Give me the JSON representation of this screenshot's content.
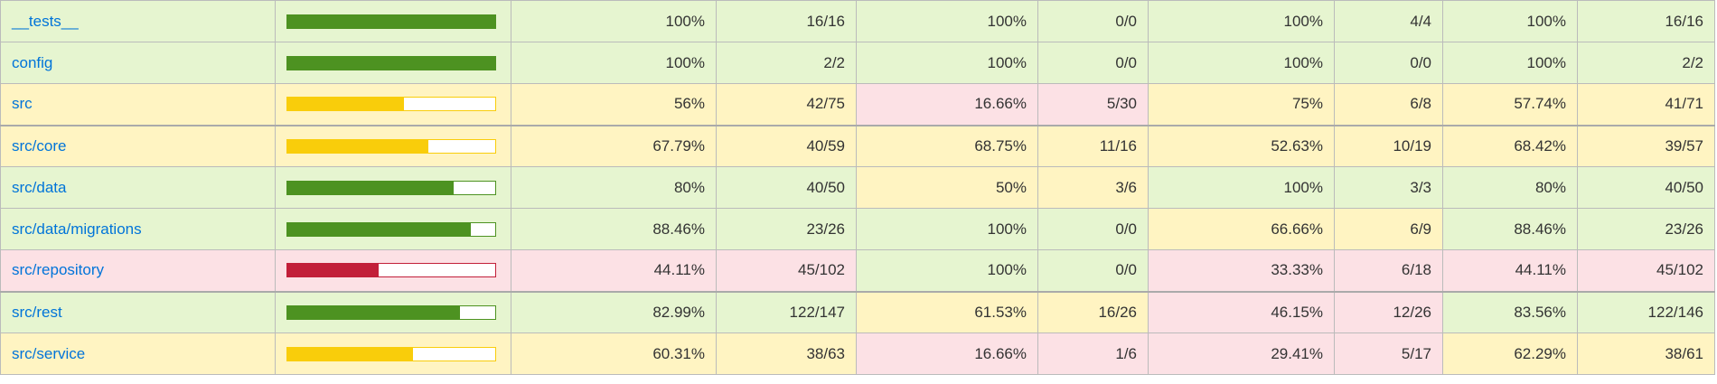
{
  "colors": {
    "high_bg": "#e6f5d0",
    "medium_bg": "#fff4c2",
    "low_bg": "#fce1e5",
    "high_bar": "#4d9221",
    "medium_bar": "#f9cd0b",
    "low_bar": "#c21f39",
    "link": "#0074d9"
  },
  "rows": [
    {
      "file": "__tests__",
      "bar_level": "high",
      "bar_fraction": 1.0,
      "statements_pct": "100%",
      "statements_ratio": "16/16",
      "statements_level": "high",
      "branches_pct": "100%",
      "branches_ratio": "0/0",
      "branches_level": "high",
      "functions_pct": "100%",
      "functions_ratio": "4/4",
      "functions_level": "high",
      "lines_pct": "100%",
      "lines_ratio": "16/16",
      "lines_level": "high"
    },
    {
      "file": "config",
      "bar_level": "high",
      "bar_fraction": 1.0,
      "statements_pct": "100%",
      "statements_ratio": "2/2",
      "statements_level": "high",
      "branches_pct": "100%",
      "branches_ratio": "0/0",
      "branches_level": "high",
      "functions_pct": "100%",
      "functions_ratio": "0/0",
      "functions_level": "high",
      "lines_pct": "100%",
      "lines_ratio": "2/2",
      "lines_level": "high"
    },
    {
      "file": "src",
      "bar_level": "medium",
      "bar_fraction": 0.56,
      "statements_pct": "56%",
      "statements_ratio": "42/75",
      "statements_level": "medium",
      "branches_pct": "16.66%",
      "branches_ratio": "5/30",
      "branches_level": "low",
      "functions_pct": "75%",
      "functions_ratio": "6/8",
      "functions_level": "medium",
      "lines_pct": "57.74%",
      "lines_ratio": "41/71",
      "lines_level": "medium"
    },
    {
      "file": "src/core",
      "bar_level": "medium",
      "bar_fraction": 0.6779,
      "statements_pct": "67.79%",
      "statements_ratio": "40/59",
      "statements_level": "medium",
      "branches_pct": "68.75%",
      "branches_ratio": "11/16",
      "branches_level": "medium",
      "functions_pct": "52.63%",
      "functions_ratio": "10/19",
      "functions_level": "medium",
      "lines_pct": "68.42%",
      "lines_ratio": "39/57",
      "lines_level": "medium"
    },
    {
      "file": "src/data",
      "bar_level": "high",
      "bar_fraction": 0.8,
      "statements_pct": "80%",
      "statements_ratio": "40/50",
      "statements_level": "high",
      "branches_pct": "50%",
      "branches_ratio": "3/6",
      "branches_level": "medium",
      "functions_pct": "100%",
      "functions_ratio": "3/3",
      "functions_level": "high",
      "lines_pct": "80%",
      "lines_ratio": "40/50",
      "lines_level": "high"
    },
    {
      "file": "src/data/migrations",
      "bar_level": "high",
      "bar_fraction": 0.8846,
      "statements_pct": "88.46%",
      "statements_ratio": "23/26",
      "statements_level": "high",
      "branches_pct": "100%",
      "branches_ratio": "0/0",
      "branches_level": "high",
      "functions_pct": "66.66%",
      "functions_ratio": "6/9",
      "functions_level": "medium",
      "lines_pct": "88.46%",
      "lines_ratio": "23/26",
      "lines_level": "high"
    },
    {
      "file": "src/repository",
      "bar_level": "low",
      "bar_fraction": 0.4411,
      "statements_pct": "44.11%",
      "statements_ratio": "45/102",
      "statements_level": "low",
      "branches_pct": "100%",
      "branches_ratio": "0/0",
      "branches_level": "high",
      "functions_pct": "33.33%",
      "functions_ratio": "6/18",
      "functions_level": "low",
      "lines_pct": "44.11%",
      "lines_ratio": "45/102",
      "lines_level": "low"
    },
    {
      "file": "src/rest",
      "bar_level": "high",
      "bar_fraction": 0.8299,
      "statements_pct": "82.99%",
      "statements_ratio": "122/147",
      "statements_level": "high",
      "branches_pct": "61.53%",
      "branches_ratio": "16/26",
      "branches_level": "medium",
      "functions_pct": "46.15%",
      "functions_ratio": "12/26",
      "functions_level": "low",
      "lines_pct": "83.56%",
      "lines_ratio": "122/146",
      "lines_level": "high"
    },
    {
      "file": "src/service",
      "bar_level": "medium",
      "bar_fraction": 0.6031,
      "statements_pct": "60.31%",
      "statements_ratio": "38/63",
      "statements_level": "medium",
      "branches_pct": "16.66%",
      "branches_ratio": "1/6",
      "branches_level": "low",
      "functions_pct": "29.41%",
      "functions_ratio": "5/17",
      "functions_level": "low",
      "lines_pct": "62.29%",
      "lines_ratio": "38/61",
      "lines_level": "medium"
    }
  ]
}
